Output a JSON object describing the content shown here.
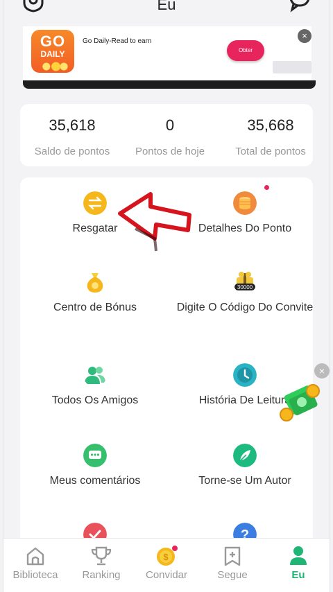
{
  "header": {
    "title": "Eu",
    "left_icon": "settings-icon",
    "right_icon": "message-icon"
  },
  "ad": {
    "logo_line1": "GO",
    "logo_line2": "DAILY",
    "text": "Go Daily-Read to earn",
    "button": "Obter",
    "close": "×"
  },
  "stats": [
    {
      "value": "35,618",
      "label": "Saldo de pontos"
    },
    {
      "value": "0",
      "label": "Pontos de hoje"
    },
    {
      "value": "35,668",
      "label": "Total de pontos"
    }
  ],
  "menu": [
    {
      "label": "Resgatar",
      "icon": "exchange-icon",
      "color": "#f5b71c"
    },
    {
      "label": "Detalhes Do Ponto",
      "icon": "coins-stack-icon",
      "color": "#f08a3c"
    },
    {
      "label": "Centro de Bónus",
      "icon": "money-bag-icon",
      "color": "#f5c12a"
    },
    {
      "label": "Digite O Código Do Convite",
      "icon": "gift-30000-icon",
      "color": "#f2c73b"
    },
    {
      "label": "Todos Os Amigos",
      "icon": "friends-icon",
      "color": "#2fba7e"
    },
    {
      "label": "História De Leitura",
      "icon": "clock-icon",
      "color": "#29b3c4"
    },
    {
      "label": "Meus comentários",
      "icon": "comment-icon",
      "color": "#36c06e"
    },
    {
      "label": "Torne-se Um Autor",
      "icon": "feather-icon",
      "color": "#1dba80"
    },
    {
      "label": "",
      "icon": "check-icon",
      "color": "#e9525a"
    },
    {
      "label": "",
      "icon": "help-icon",
      "color": "#3b7de0"
    }
  ],
  "gift_badge": "30000",
  "floating_close": "×",
  "nav": [
    {
      "label": "Biblioteca",
      "icon": "library-icon"
    },
    {
      "label": "Ranking",
      "icon": "trophy-icon"
    },
    {
      "label": "Convidar",
      "icon": "coin-icon"
    },
    {
      "label": "Segue",
      "icon": "bookmark-plus-icon"
    },
    {
      "label": "Eu",
      "icon": "profile-icon",
      "active": true
    }
  ],
  "colors": {
    "accent": "#1fb574",
    "ad_button": "#e8245c",
    "badge": "#e8245c"
  }
}
